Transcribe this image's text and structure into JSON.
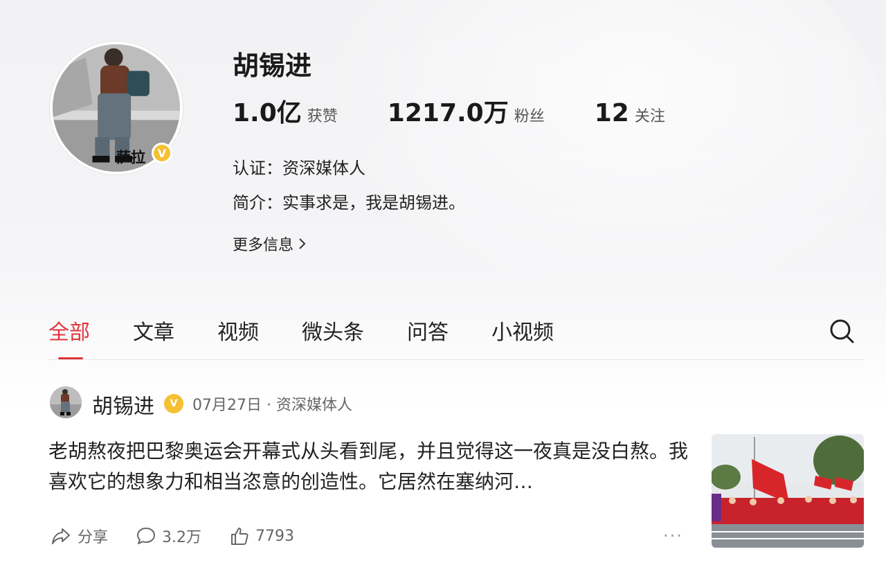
{
  "profile": {
    "name": "胡锡进",
    "avatar_caption": "萨拉",
    "stats": [
      {
        "value": "1.0亿",
        "label": "获赞"
      },
      {
        "value": "1217.0万",
        "label": "粉丝"
      },
      {
        "value": "12",
        "label": "关注"
      }
    ],
    "certification": "认证：资深媒体人",
    "intro": "简介：实事求是，我是胡锡进。",
    "more_info": "更多信息"
  },
  "tabs": [
    {
      "label": "全部",
      "active": true
    },
    {
      "label": "文章",
      "active": false
    },
    {
      "label": "视频",
      "active": false
    },
    {
      "label": "微头条",
      "active": false
    },
    {
      "label": "问答",
      "active": false
    },
    {
      "label": "小视频",
      "active": false
    }
  ],
  "post": {
    "author": "胡锡进",
    "meta": "07月27日 · 资深媒体人",
    "text": "老胡熬夜把巴黎奥运会开幕式从头看到尾，并且觉得这一夜真是没白熬。我喜欢它的想象力和相当恣意的创造性。它居然在塞纳河…",
    "actions": {
      "share": "分享",
      "comments": "3.2万",
      "likes": "7793"
    }
  },
  "colors": {
    "accent": "#e0343a",
    "verified": "#f5c132"
  },
  "icons": {
    "search": "search-icon",
    "share": "share-icon",
    "comment": "comment-icon",
    "like": "thumbs-up-icon",
    "more": "more-dots-icon",
    "chevron": "chevron-right-icon"
  }
}
